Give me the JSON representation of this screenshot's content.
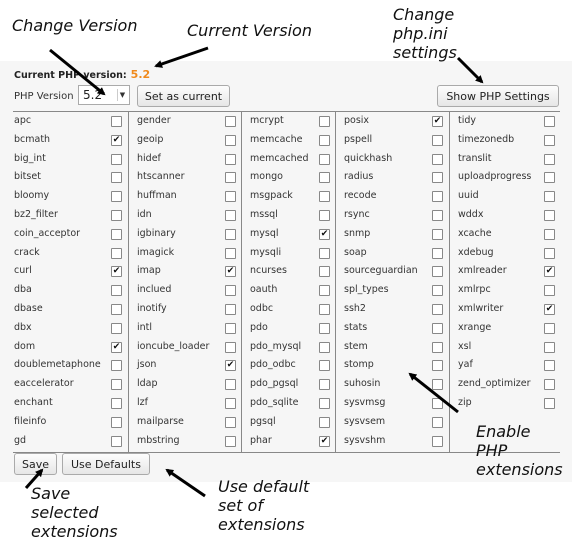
{
  "header": {
    "current_label": "Current PHP version:",
    "current_value": "5.2",
    "version_label": "PHP Version",
    "version_selected": "5.2",
    "set_current_label": "Set as current",
    "show_settings_label": "Show PHP Settings"
  },
  "columns": [
    [
      {
        "name": "apc",
        "checked": false
      },
      {
        "name": "bcmath",
        "checked": true
      },
      {
        "name": "big_int",
        "checked": false
      },
      {
        "name": "bitset",
        "checked": false
      },
      {
        "name": "bloomy",
        "checked": false
      },
      {
        "name": "bz2_filter",
        "checked": false
      },
      {
        "name": "coin_acceptor",
        "checked": false
      },
      {
        "name": "crack",
        "checked": false
      },
      {
        "name": "curl",
        "checked": true
      },
      {
        "name": "dba",
        "checked": false
      },
      {
        "name": "dbase",
        "checked": false
      },
      {
        "name": "dbx",
        "checked": false
      },
      {
        "name": "dom",
        "checked": true
      },
      {
        "name": "doublemetaphone",
        "checked": false
      },
      {
        "name": "eaccelerator",
        "checked": false
      },
      {
        "name": "enchant",
        "checked": false
      },
      {
        "name": "fileinfo",
        "checked": false
      },
      {
        "name": "gd",
        "checked": false
      }
    ],
    [
      {
        "name": "gender",
        "checked": false
      },
      {
        "name": "geoip",
        "checked": false
      },
      {
        "name": "hidef",
        "checked": false
      },
      {
        "name": "htscanner",
        "checked": false
      },
      {
        "name": "huffman",
        "checked": false
      },
      {
        "name": "idn",
        "checked": false
      },
      {
        "name": "igbinary",
        "checked": false
      },
      {
        "name": "imagick",
        "checked": false
      },
      {
        "name": "imap",
        "checked": true
      },
      {
        "name": "inclued",
        "checked": false
      },
      {
        "name": "inotify",
        "checked": false
      },
      {
        "name": "intl",
        "checked": false
      },
      {
        "name": "ioncube_loader",
        "checked": false
      },
      {
        "name": "json",
        "checked": true
      },
      {
        "name": "ldap",
        "checked": false
      },
      {
        "name": "lzf",
        "checked": false
      },
      {
        "name": "mailparse",
        "checked": false
      },
      {
        "name": "mbstring",
        "checked": false
      }
    ],
    [
      {
        "name": "mcrypt",
        "checked": false
      },
      {
        "name": "memcache",
        "checked": false
      },
      {
        "name": "memcached",
        "checked": false
      },
      {
        "name": "mongo",
        "checked": false
      },
      {
        "name": "msgpack",
        "checked": false
      },
      {
        "name": "mssql",
        "checked": false
      },
      {
        "name": "mysql",
        "checked": true
      },
      {
        "name": "mysqli",
        "checked": false
      },
      {
        "name": "ncurses",
        "checked": false
      },
      {
        "name": "oauth",
        "checked": false
      },
      {
        "name": "odbc",
        "checked": false
      },
      {
        "name": "pdo",
        "checked": false
      },
      {
        "name": "pdo_mysql",
        "checked": false
      },
      {
        "name": "pdo_odbc",
        "checked": false
      },
      {
        "name": "pdo_pgsql",
        "checked": false
      },
      {
        "name": "pdo_sqlite",
        "checked": false
      },
      {
        "name": "pgsql",
        "checked": false
      },
      {
        "name": "phar",
        "checked": true
      }
    ],
    [
      {
        "name": "posix",
        "checked": true
      },
      {
        "name": "pspell",
        "checked": false
      },
      {
        "name": "quickhash",
        "checked": false
      },
      {
        "name": "radius",
        "checked": false
      },
      {
        "name": "recode",
        "checked": false
      },
      {
        "name": "rsync",
        "checked": false
      },
      {
        "name": "snmp",
        "checked": false
      },
      {
        "name": "soap",
        "checked": false
      },
      {
        "name": "sourceguardian",
        "checked": false
      },
      {
        "name": "spl_types",
        "checked": false
      },
      {
        "name": "ssh2",
        "checked": false
      },
      {
        "name": "stats",
        "checked": false
      },
      {
        "name": "stem",
        "checked": false
      },
      {
        "name": "stomp",
        "checked": false
      },
      {
        "name": "suhosin",
        "checked": false
      },
      {
        "name": "sysvmsg",
        "checked": false
      },
      {
        "name": "sysvsem",
        "checked": false
      },
      {
        "name": "sysvshm",
        "checked": false
      }
    ],
    [
      {
        "name": "tidy",
        "checked": false
      },
      {
        "name": "timezonedb",
        "checked": false
      },
      {
        "name": "translit",
        "checked": false
      },
      {
        "name": "uploadprogress",
        "checked": false
      },
      {
        "name": "uuid",
        "checked": false
      },
      {
        "name": "wddx",
        "checked": false
      },
      {
        "name": "xcache",
        "checked": false
      },
      {
        "name": "xdebug",
        "checked": false
      },
      {
        "name": "xmlreader",
        "checked": true
      },
      {
        "name": "xmlrpc",
        "checked": false
      },
      {
        "name": "xmlwriter",
        "checked": true
      },
      {
        "name": "xrange",
        "checked": false
      },
      {
        "name": "xsl",
        "checked": false
      },
      {
        "name": "yaf",
        "checked": false
      },
      {
        "name": "zend_optimizer",
        "checked": false
      },
      {
        "name": "zip",
        "checked": false
      }
    ]
  ],
  "footer": {
    "save_label": "Save",
    "defaults_label": "Use Defaults"
  },
  "annotations": {
    "change_version": "Change Version",
    "current_version": "Current Version",
    "change_ini_1": "Change",
    "change_ini_2": "php.ini",
    "change_ini_3": "settings",
    "enable_1": "Enable",
    "enable_2": "PHP",
    "enable_3": "extensions",
    "save_1": "Save",
    "save_2": "selected",
    "save_3": "extensions",
    "defaults_1": "Use default",
    "defaults_2": "set of",
    "defaults_3": "extensions"
  },
  "check_glyph": "✔"
}
